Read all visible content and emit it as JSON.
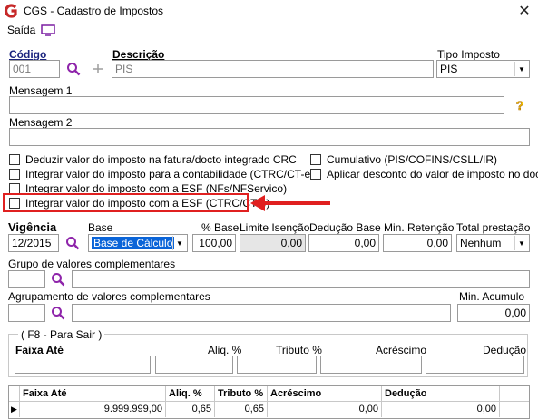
{
  "window": {
    "title": "CGS - Cadastro de Impostos",
    "close_glyph": "✕"
  },
  "menu": {
    "saida": "Saída"
  },
  "codigo": {
    "label": "Código",
    "value": "001"
  },
  "descricao": {
    "label": "Descrição",
    "value": "PIS"
  },
  "tipo_imposto": {
    "label": "Tipo Imposto",
    "value": "PIS"
  },
  "mensagem1": {
    "label": "Mensagem 1",
    "value": ""
  },
  "mensagem2": {
    "label": "Mensagem 2",
    "value": ""
  },
  "checks": {
    "deduzir": "Deduzir valor do imposto na fatura/docto integrado CRC",
    "integrar_contab": "Integrar valor do imposto para a contabilidade (CTRC/CT-e)",
    "integrar_esf_nfs": "Integrar valor do imposto com a ESF (NFs/NFServico)",
    "integrar_esf_ctrc": "Integrar valor do imposto com a ESF (CTRC/CT-e)",
    "cumulativo": "Cumulativo (PIS/COFINS/CSLL/IR)",
    "aplicar_desconto": "Aplicar desconto do valor de imposto no docto"
  },
  "vigencia": {
    "label": "Vigência",
    "value": "12/2015"
  },
  "base": {
    "label": "Base",
    "value": "Base de Cálculo"
  },
  "pct_base": {
    "label": "% Base",
    "value": "100,00"
  },
  "limite_isencao": {
    "label": "Limite Isenção",
    "value": "0,00"
  },
  "deducao_base": {
    "label": "Dedução Base",
    "value": "0,00"
  },
  "min_retencao": {
    "label": "Min. Retenção",
    "value": "0,00"
  },
  "total_prestacao": {
    "label": "Total prestação",
    "value": "Nenhum"
  },
  "grupo_valores": {
    "label": "Grupo de valores complementares"
  },
  "agrupamento_valores": {
    "label": "Agrupamento de valores complementares"
  },
  "min_acumulo": {
    "label": "Min. Acumulo",
    "value": "0,00"
  },
  "faixa_group": {
    "legend": "( F8 - Para Sair )",
    "labels": {
      "faixa_ate": "Faixa Até",
      "aliq": "Aliq. %",
      "tributo": "Tributo %",
      "acrescimo": "Acréscimo",
      "deducao": "Dedução"
    }
  },
  "grid": {
    "headers": [
      "Faixa Até",
      "Aliq. %",
      "Tributo %",
      "Acréscimo",
      "Dedução"
    ],
    "row": [
      "9.999.999,00",
      "0,65",
      "0,65",
      "0,00",
      "0,00"
    ]
  },
  "colors": {
    "highlight_box": "#e02020",
    "arrow": "#e02020",
    "selection": "#0a64d8"
  }
}
